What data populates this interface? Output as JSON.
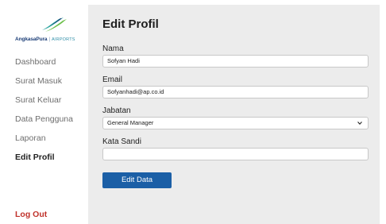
{
  "brand": {
    "name": "AngkasaPura",
    "separator": "|",
    "sub": "AIRPORTS",
    "logo_icon": "angkasa-pura-logo"
  },
  "sidebar": {
    "items": [
      {
        "label": "Dashboard",
        "active": false
      },
      {
        "label": "Surat Masuk",
        "active": false
      },
      {
        "label": "Surat Keluar",
        "active": false
      },
      {
        "label": "Data Pengguna",
        "active": false
      },
      {
        "label": "Laporan",
        "active": false
      },
      {
        "label": "Edit Profil",
        "active": true
      }
    ],
    "logout_label": "Log Out"
  },
  "main": {
    "title": "Edit Profil",
    "fields": {
      "nama": {
        "label": "Nama",
        "value": "Sofyan Hadi"
      },
      "email": {
        "label": "Email",
        "value": "Sofyanhadi@ap.co.id"
      },
      "jabatan": {
        "label": "Jabatan",
        "value": "General Manager"
      },
      "kata_sandi": {
        "label": "Kata Sandi",
        "value": ""
      }
    },
    "submit_label": "Edit Data"
  },
  "colors": {
    "accent": "#1b5fa6",
    "logout": "#c0322b",
    "panel_bg": "#ececec"
  }
}
